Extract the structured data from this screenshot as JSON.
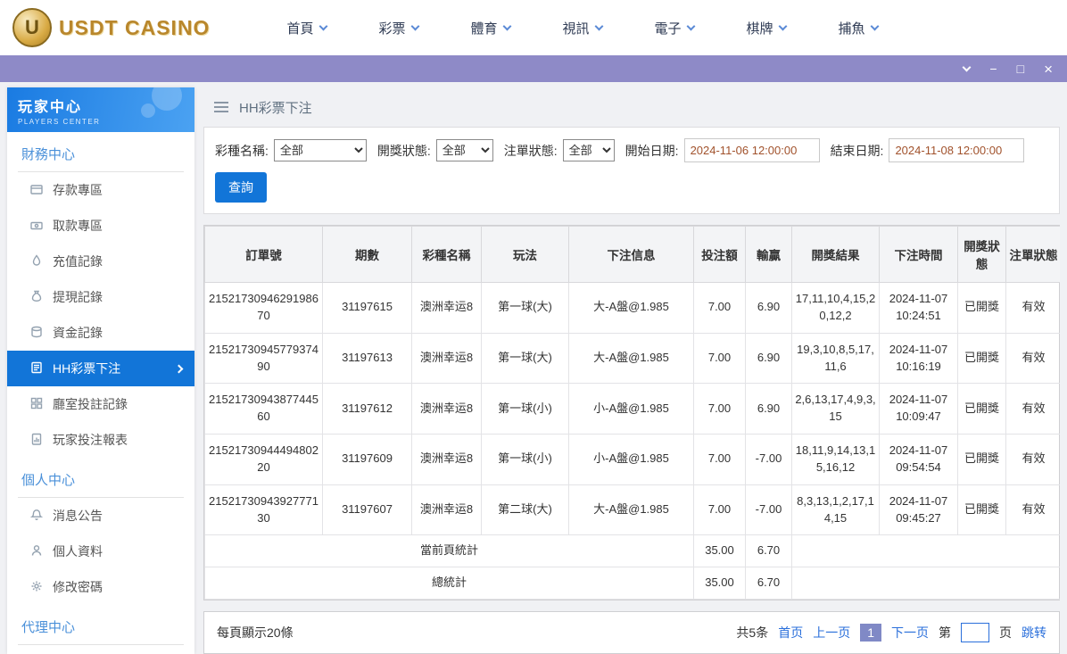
{
  "theme": {
    "accent_blue": "#1275d8",
    "titlebar_purple": "#8e8ac7",
    "logo_gold": "#b9872c",
    "link_blue": "#2a6fdb",
    "date_text": "#a1522c"
  },
  "header": {
    "logo_text": "USDT CASINO",
    "logo_letter": "U",
    "nav": [
      {
        "label": "首頁",
        "icon": "chevron-down-icon"
      },
      {
        "label": "彩票",
        "icon": "chevron-down-icon"
      },
      {
        "label": "體育",
        "icon": "chevron-down-icon"
      },
      {
        "label": "視訊",
        "icon": "chevron-down-icon"
      },
      {
        "label": "電子",
        "icon": "chevron-down-icon"
      },
      {
        "label": "棋牌",
        "icon": "chevron-down-icon"
      },
      {
        "label": "捕魚",
        "icon": "chevron-down-icon"
      }
    ]
  },
  "titlebar": {
    "controls": [
      "collapse-icon",
      "minimize-icon",
      "maximize-icon",
      "close-icon"
    ],
    "minimize_glyph": "−",
    "maximize_glyph": "□",
    "close_glyph": "×"
  },
  "sidebar": {
    "title": "玩家中心",
    "subtitle": "PLAYERS CENTER",
    "sections": [
      {
        "title": "財務中心",
        "items": [
          {
            "label": "存款專區",
            "icon": "deposit-icon",
            "active": false
          },
          {
            "label": "取款專區",
            "icon": "withdraw-icon",
            "active": false
          },
          {
            "label": "充值記錄",
            "icon": "recharge-record-icon",
            "active": false
          },
          {
            "label": "提現記錄",
            "icon": "withdrawal-record-icon",
            "active": false
          },
          {
            "label": "資金記錄",
            "icon": "funds-record-icon",
            "active": false
          },
          {
            "label": "HH彩票下注",
            "icon": "lottery-bet-icon",
            "active": true
          },
          {
            "label": "廳室投註記錄",
            "icon": "hall-bet-record-icon",
            "active": false
          },
          {
            "label": "玩家投注報表",
            "icon": "bet-report-icon",
            "active": false
          }
        ]
      },
      {
        "title": "個人中心",
        "items": [
          {
            "label": "消息公告",
            "icon": "bell-icon",
            "active": false
          },
          {
            "label": "個人資料",
            "icon": "person-icon",
            "active": false
          },
          {
            "label": "修改密碼",
            "icon": "gear-icon",
            "active": false
          }
        ]
      },
      {
        "title": "代理中心",
        "items": []
      }
    ]
  },
  "breadcrumb": {
    "title": "HH彩票下注"
  },
  "filters": {
    "lottery_label": "彩種名稱:",
    "lottery_value": "全部",
    "draw_status_label": "開獎狀態:",
    "draw_status_value": "全部",
    "order_status_label": "注單狀態:",
    "order_status_value": "全部",
    "start_label": "開始日期:",
    "start_value": "2024-11-06 12:00:00",
    "end_label": "結束日期:",
    "end_value": "2024-11-08 12:00:00",
    "search_label": "查詢"
  },
  "table": {
    "headers": [
      "訂單號",
      "期數",
      "彩種名稱",
      "玩法",
      "下注信息",
      "投注額",
      "輸贏",
      "開獎結果",
      "下注時間",
      "開獎狀態",
      "注單狀態"
    ],
    "rows": [
      {
        "order": "2152173094629198670",
        "period": "31197615",
        "lottery": "澳洲幸运8",
        "play": "第一球(大)",
        "info": "大-A盤@1.985",
        "bet": "7.00",
        "winloss": "6.90",
        "result": "17,11,10,4,15,20,12,2",
        "time": "2024-11-07 10:24:51",
        "draw_status": "已開獎",
        "order_status": "有效"
      },
      {
        "order": "2152173094577937490",
        "period": "31197613",
        "lottery": "澳洲幸运8",
        "play": "第一球(大)",
        "info": "大-A盤@1.985",
        "bet": "7.00",
        "winloss": "6.90",
        "result": "19,3,10,8,5,17,11,6",
        "time": "2024-11-07 10:16:19",
        "draw_status": "已開獎",
        "order_status": "有效"
      },
      {
        "order": "2152173094387744560",
        "period": "31197612",
        "lottery": "澳洲幸运8",
        "play": "第一球(小)",
        "info": "小-A盤@1.985",
        "bet": "7.00",
        "winloss": "6.90",
        "result": "2,6,13,17,4,9,3,15",
        "time": "2024-11-07 10:09:47",
        "draw_status": "已開獎",
        "order_status": "有效"
      },
      {
        "order": "2152173094449480220",
        "period": "31197609",
        "lottery": "澳洲幸运8",
        "play": "第一球(小)",
        "info": "小-A盤@1.985",
        "bet": "7.00",
        "winloss": "-7.00",
        "result": "18,11,9,14,13,15,16,12",
        "time": "2024-11-07 09:54:54",
        "draw_status": "已開獎",
        "order_status": "有效"
      },
      {
        "order": "2152173094392777130",
        "period": "31197607",
        "lottery": "澳洲幸运8",
        "play": "第二球(大)",
        "info": "大-A盤@1.985",
        "bet": "7.00",
        "winloss": "-7.00",
        "result": "8,3,13,1,2,17,14,15",
        "time": "2024-11-07 09:45:27",
        "draw_status": "已開獎",
        "order_status": "有效"
      }
    ],
    "page_summary": {
      "label": "當前頁統計",
      "bet": "35.00",
      "winloss": "6.70"
    },
    "total_summary": {
      "label": "總統計",
      "bet": "35.00",
      "winloss": "6.70"
    }
  },
  "pagination": {
    "per_page": "每頁顯示20條",
    "total": "共5条",
    "first": "首页",
    "prev": "上一页",
    "current": "1",
    "next": "下一页",
    "jump_prefix": "第",
    "jump_suffix": "页",
    "jump_button": "跳转"
  }
}
